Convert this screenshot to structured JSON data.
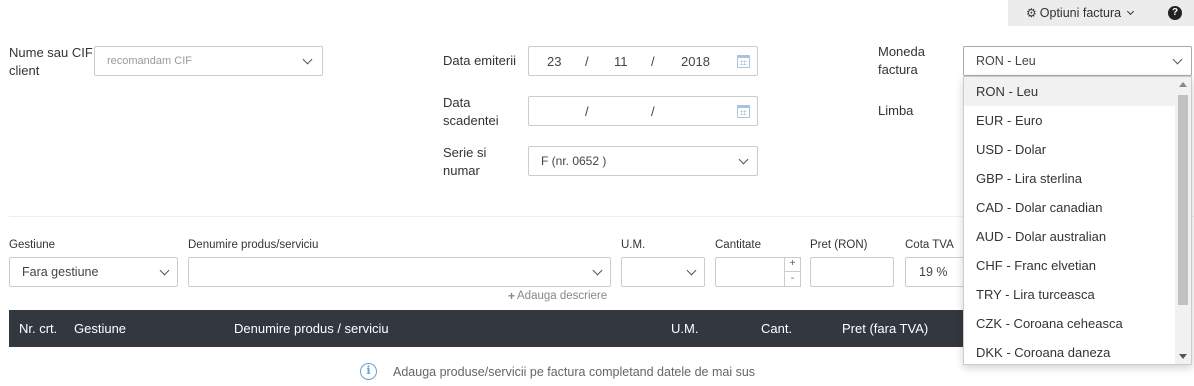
{
  "toolbar": {
    "options_label": "Optiuni factura",
    "help_icon": "question-circle-icon",
    "options_icon": "gear-icon"
  },
  "client": {
    "label": "Nume sau CIF client",
    "placeholder": "recomandam CIF"
  },
  "issue_date": {
    "label": "Data emiterii",
    "day": "23",
    "month": "11",
    "year": "2018",
    "separator": "/"
  },
  "due_date": {
    "label": "Data scadentei",
    "day": "",
    "month": "",
    "year": "",
    "separator": "/"
  },
  "series": {
    "label": "Serie si numar",
    "value": "F (nr. 0652 )"
  },
  "currency": {
    "label": "Moneda factura",
    "selected": "RON - Leu",
    "options": [
      "RON - Leu",
      "EUR - Euro",
      "USD - Dolar",
      "GBP - Lira sterlina",
      "CAD - Dolar canadian",
      "AUD - Dolar australian",
      "CHF - Franc elvetian",
      "TRY - Lira turceasca",
      "CZK - Coroana ceheasca",
      "DKK - Coroana daneza"
    ]
  },
  "language": {
    "label": "Limba"
  },
  "product_form": {
    "gestiune_label": "Gestiune",
    "gestiune_value": "Fara gestiune",
    "product_label": "Denumire produs/serviciu",
    "um_label": "U.M.",
    "qty_label": "Cantitate",
    "price_label": "Pret (RON)",
    "vat_label": "Cota TVA",
    "vat_value": "19 %",
    "add_description": "Adauga descriere",
    "plus": "+",
    "minus": "-"
  },
  "table": {
    "columns": [
      "Nr. crt.",
      "Gestiune",
      "Denumire produs / serviciu",
      "U.M.",
      "Cant.",
      "Pret (fara TVA)"
    ],
    "empty_message": "Adauga produse/servicii pe factura completand datele de mai sus"
  },
  "colors": {
    "header_bg": "#333840",
    "accent_icon": "#a9c3de"
  }
}
